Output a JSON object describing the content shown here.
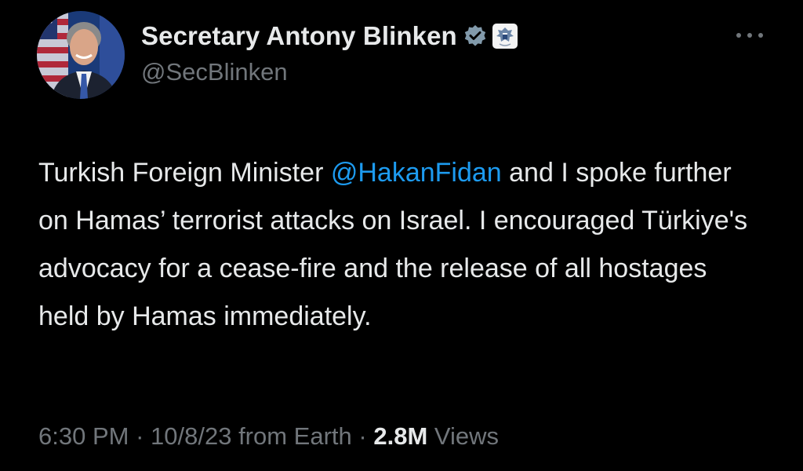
{
  "author": {
    "display_name": "Secretary Antony Blinken",
    "handle": "@SecBlinken",
    "avatar_icon": "profile-photo",
    "verified_icon": "verified-badge-icon",
    "affiliation_icon": "us-government-seal-icon"
  },
  "menu": {
    "icon": "more-options-icon"
  },
  "tweet": {
    "text_before": "Turkish Foreign Minister ",
    "mention": "@HakanFidan",
    "text_after": " and I spoke further on Hamas’ terrorist attacks on Israel. I encouraged Türkiye's advocacy for a cease-fire and the release of all hostages held by Hamas immediately."
  },
  "meta": {
    "time": "6:30 PM",
    "separator": " · ",
    "date": "10/8/23",
    "source": " from Earth",
    "views_count": "2.8M",
    "views_label": " Views"
  },
  "colors": {
    "background": "#000000",
    "text": "#e7e9ea",
    "secondary": "#71767b",
    "link": "#1d9bf0"
  }
}
